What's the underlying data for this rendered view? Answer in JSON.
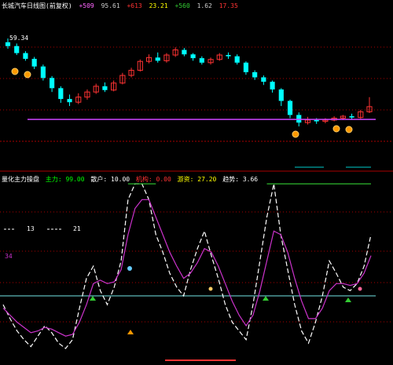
{
  "header": {
    "title": "长城汽车日线图(前复权)",
    "items": [
      {
        "text": "+509 ",
        "color": "#ff66ff"
      },
      {
        "text": "95.61",
        "color": "#cccccc"
      },
      {
        "text": "+613",
        "color": "#ff3333"
      },
      {
        "text": "23.21",
        "color": "#ffff00"
      },
      {
        "text": "+560",
        "color": "#33cc33"
      },
      {
        "text": "1.62",
        "color": "#cccccc"
      },
      {
        "text": "17.35",
        "color": "#ff3333"
      }
    ]
  },
  "price_label": "59.34",
  "indicator_header": {
    "title": "量化主力操盘",
    "items": [
      {
        "text": "主力: 99.00",
        "color": "#00ff00"
      },
      {
        "text": "散户: 10.00",
        "color": "#ffffff"
      },
      {
        "text": "机构: 0.00",
        "color": "#ff3333"
      },
      {
        "text": "游资: 27.20",
        "color": "#ffff00"
      },
      {
        "text": "趋势: 3.66",
        "color": "#ffffff"
      }
    ]
  },
  "indicator_labels": {
    "left_a": "13",
    "left_b": "21",
    "left_c": "34"
  },
  "colors": {
    "up": "#ff3333",
    "down": "#00ffff",
    "support": "#cc44ff",
    "grid": "#aa0000",
    "white_line": "#ffffff",
    "magenta_line": "#cc33cc",
    "green_line": "#33cc33",
    "cyan_level": "#66cccc"
  },
  "chart_data": [
    {
      "type": "candlestick",
      "title": "长城汽车日线图(前复权)",
      "series": [
        {
          "name": "price",
          "values": [
            [
              59.8,
              59.2,
              60.4,
              58.8
            ],
            [
              59.2,
              58.1,
              59.6,
              57.8
            ],
            [
              58.1,
              57.2,
              58.4,
              56.9
            ],
            [
              57.2,
              56.0,
              57.5,
              55.6
            ],
            [
              56.0,
              54.2,
              56.3,
              53.8
            ],
            [
              54.2,
              52.6,
              54.5,
              52.0
            ],
            [
              52.6,
              50.9,
              52.9,
              50.3
            ],
            [
              50.9,
              50.4,
              51.6,
              49.8
            ],
            [
              50.4,
              51.2,
              51.8,
              50.1
            ],
            [
              51.2,
              52.0,
              52.4,
              50.8
            ],
            [
              52.0,
              52.9,
              53.3,
              51.7
            ],
            [
              52.9,
              52.3,
              53.5,
              52.0
            ],
            [
              52.3,
              53.4,
              53.8,
              52.1
            ],
            [
              53.4,
              54.6,
              55.0,
              53.2
            ],
            [
              54.6,
              55.4,
              55.8,
              54.3
            ],
            [
              55.4,
              56.8,
              57.1,
              55.2
            ],
            [
              56.8,
              57.4,
              57.9,
              56.5
            ],
            [
              57.4,
              56.9,
              58.2,
              56.6
            ],
            [
              56.9,
              57.8,
              58.1,
              56.6
            ],
            [
              57.8,
              58.6,
              59.0,
              57.5
            ],
            [
              58.6,
              57.9,
              58.9,
              57.6
            ],
            [
              57.9,
              57.3,
              58.1,
              56.9
            ],
            [
              57.3,
              56.6,
              57.6,
              56.3
            ],
            [
              56.6,
              57.1,
              57.4,
              56.3
            ],
            [
              57.1,
              57.8,
              58.1,
              56.9
            ],
            [
              57.8,
              57.6,
              58.2,
              57.2
            ],
            [
              57.6,
              56.6,
              57.9,
              56.3
            ],
            [
              56.6,
              55.1,
              56.8,
              54.7
            ],
            [
              55.1,
              54.3,
              55.4,
              53.9
            ],
            [
              54.3,
              53.6,
              54.6,
              53.1
            ],
            [
              53.6,
              52.4,
              53.8,
              51.9
            ],
            [
              52.4,
              50.6,
              52.6,
              49.8
            ],
            [
              50.6,
              48.4,
              50.8,
              47.9
            ],
            [
              48.4,
              47.2,
              48.8,
              46.6
            ],
            [
              47.2,
              47.6,
              48.1,
              46.9
            ],
            [
              47.6,
              47.4,
              47.9,
              47.0
            ],
            [
              47.4,
              47.6,
              47.9,
              47.1
            ],
            [
              47.6,
              47.9,
              48.2,
              47.4
            ],
            [
              47.9,
              48.2,
              48.4,
              47.6
            ],
            [
              48.2,
              48.0,
              48.6,
              47.7
            ],
            [
              48.0,
              48.9,
              49.2,
              47.8
            ],
            [
              48.9,
              49.7,
              51.2,
              48.7
            ]
          ]
        }
      ],
      "support_level": 47.7,
      "ylim": [
        45.5,
        61.5
      ]
    },
    {
      "type": "line",
      "title": "量化主力操盘",
      "ylim": [
        0,
        100
      ],
      "level": 35,
      "series": [
        {
          "name": "",
          "color": "#ffffff",
          "values": [
            30,
            22,
            15,
            10,
            6,
            12,
            18,
            14,
            8,
            5,
            10,
            28,
            45,
            52,
            38,
            30,
            40,
            55,
            90,
            99,
            99,
            90,
            70,
            60,
            48,
            40,
            35,
            50,
            62,
            72,
            58,
            45,
            30,
            20,
            15,
            10,
            30,
            55,
            80,
            99,
            70,
            50,
            30,
            15,
            8,
            20,
            35,
            55,
            48,
            40,
            38,
            42,
            52,
            70
          ]
        },
        {
          "name": "",
          "color": "#cc33cc",
          "values": [
            28,
            24,
            20,
            17,
            14,
            15,
            17,
            16,
            14,
            12,
            13,
            20,
            30,
            42,
            44,
            42,
            43,
            50,
            70,
            85,
            90,
            90,
            80,
            70,
            60,
            52,
            45,
            48,
            54,
            62,
            60,
            52,
            42,
            32,
            24,
            18,
            24,
            38,
            55,
            72,
            70,
            60,
            45,
            32,
            22,
            22,
            28,
            38,
            42,
            42,
            41,
            42,
            48,
            58
          ]
        },
        {
          "name": "",
          "color": "#33cc33",
          "values": [
            null,
            null,
            null,
            null,
            null,
            null,
            null,
            null,
            null,
            null,
            null,
            null,
            null,
            null,
            null,
            null,
            null,
            null,
            99,
            99,
            99,
            99,
            99,
            null,
            null,
            null,
            null,
            null,
            null,
            null,
            null,
            null,
            null,
            null,
            null,
            null,
            null,
            null,
            99,
            99,
            99,
            99,
            99,
            99,
            99,
            99,
            99,
            99,
            99,
            99,
            99,
            99,
            99,
            99
          ]
        }
      ]
    }
  ]
}
